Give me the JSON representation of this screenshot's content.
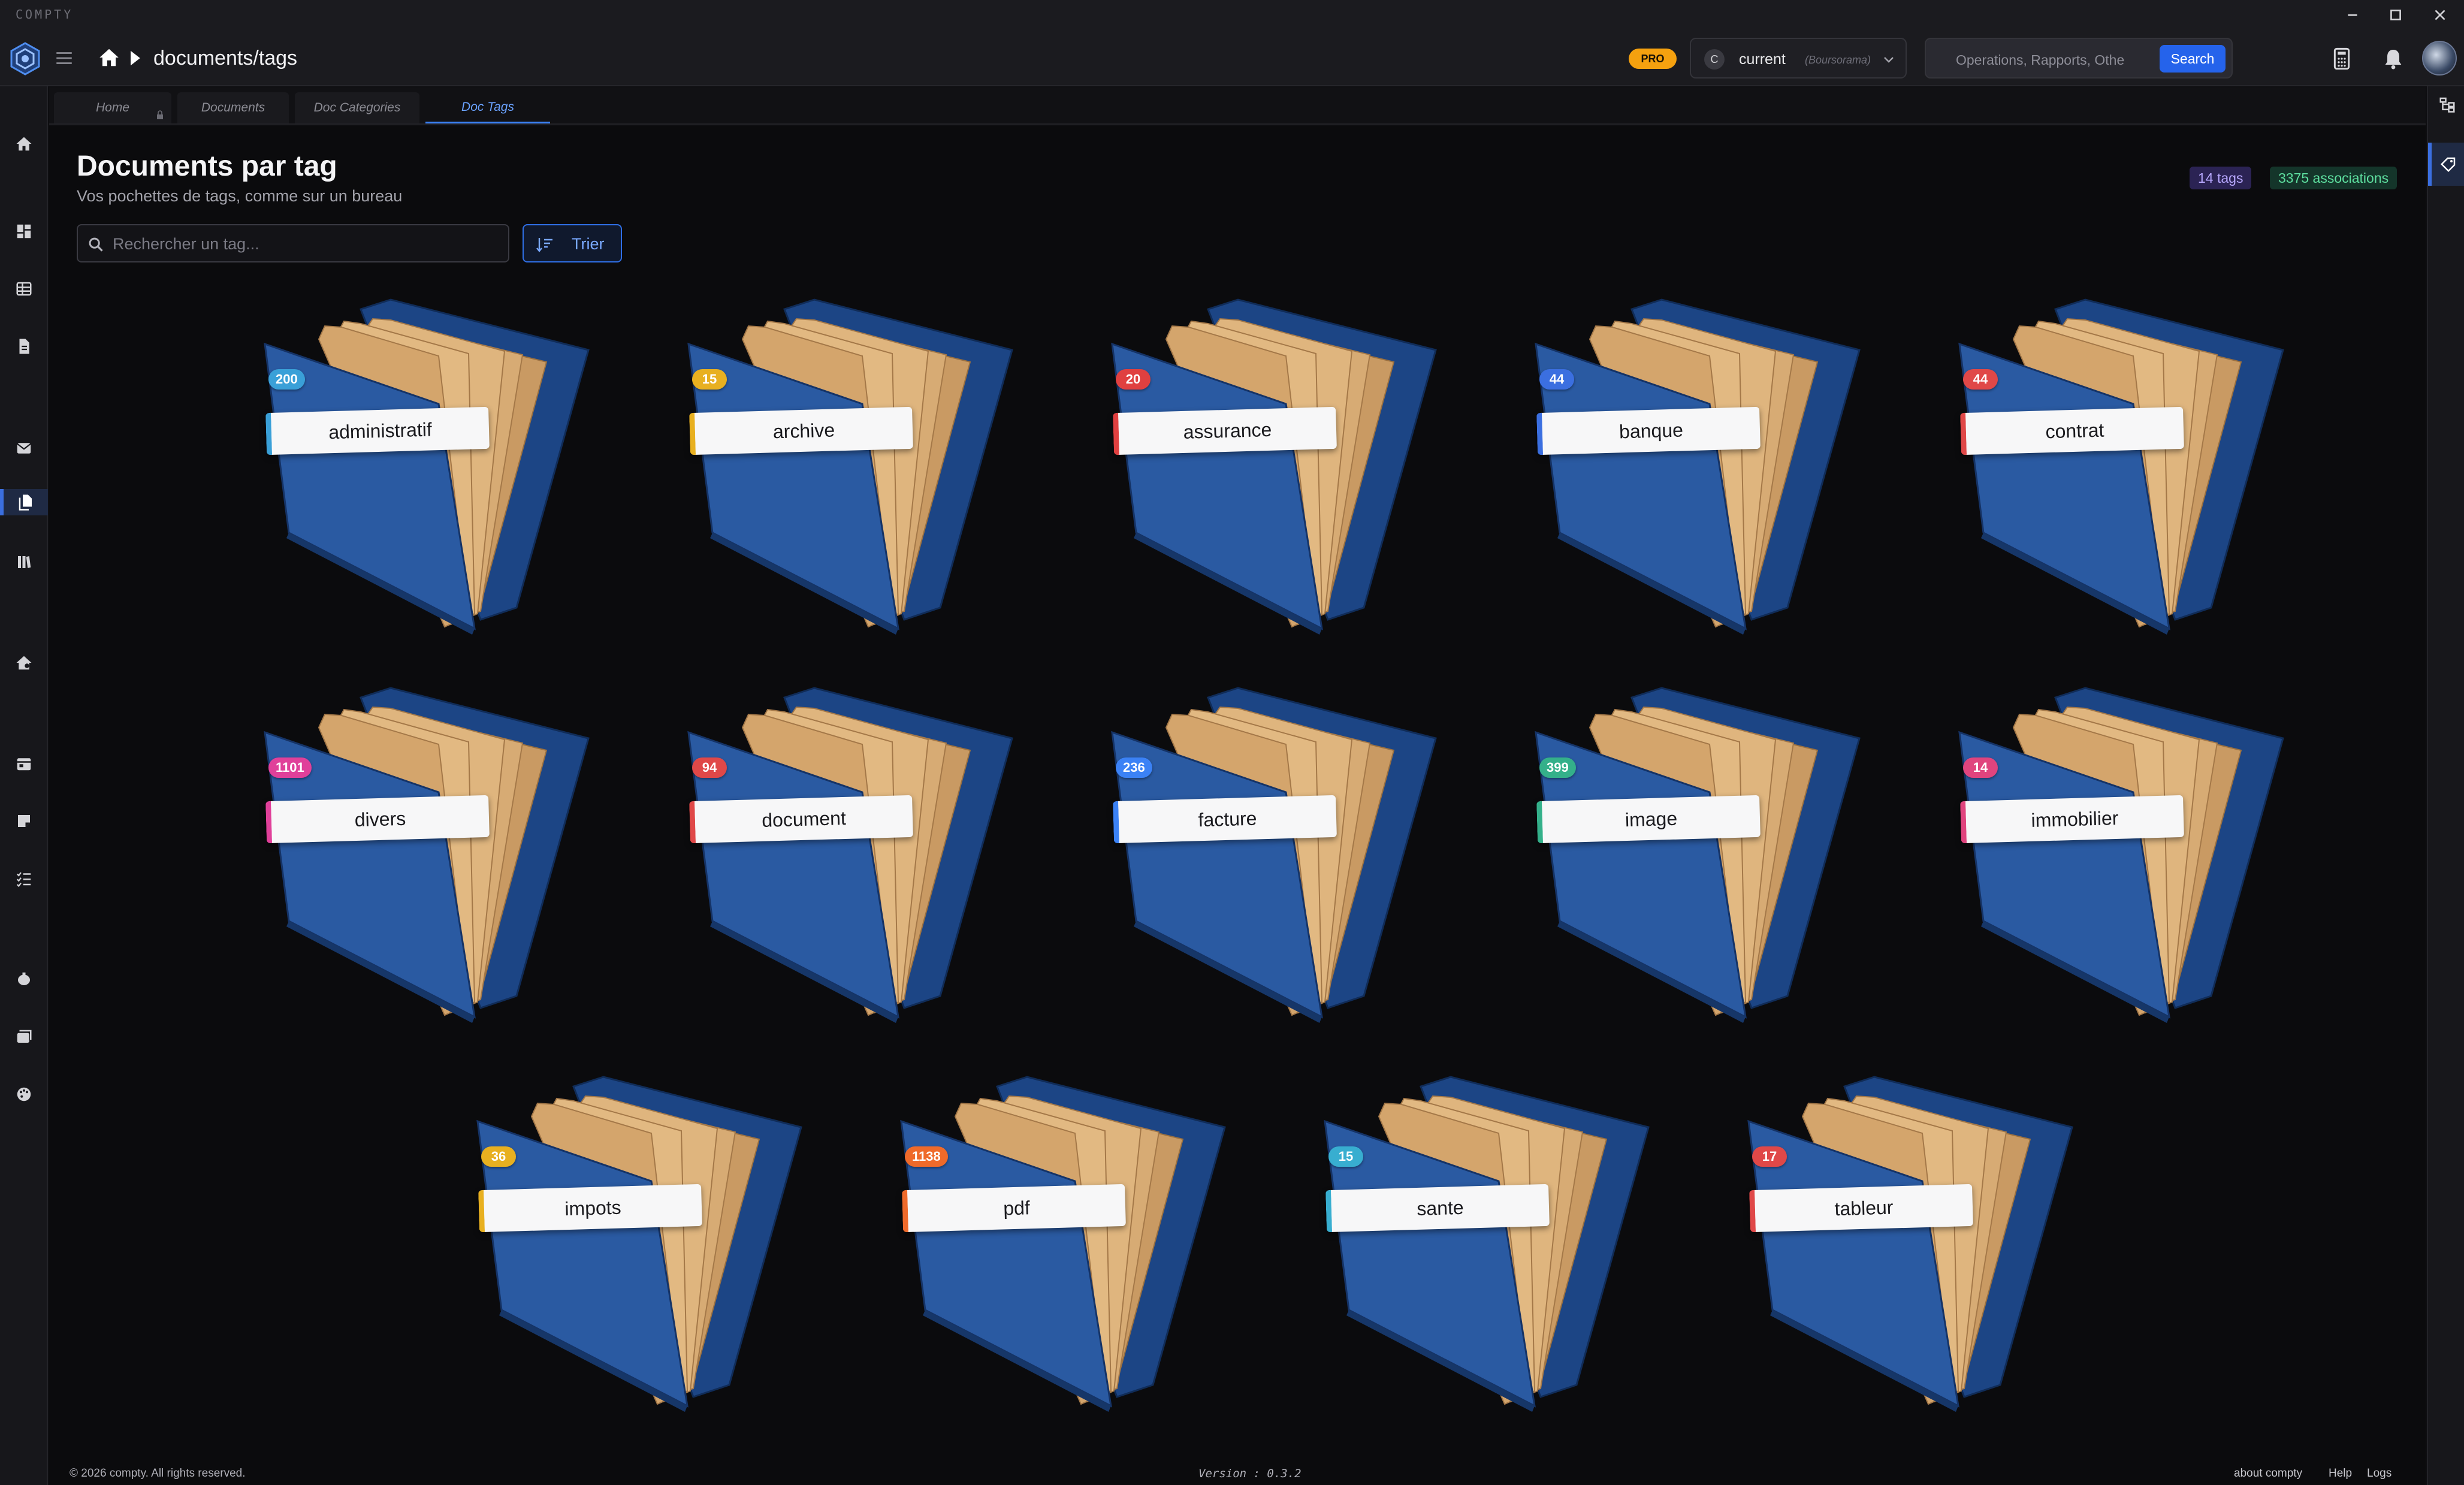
{
  "window": {
    "app_name": "COMPTY"
  },
  "header": {
    "breadcrumb_path": "documents/tags",
    "pro_label": "PRO",
    "org": {
      "avatar_letter": "C",
      "name": "current",
      "sub": "(Boursorama)"
    },
    "search": {
      "placeholder": "Operations, Rapports, Othe",
      "button_label": "Search"
    }
  },
  "tabs": [
    {
      "label": "Home"
    },
    {
      "label": "Documents"
    },
    {
      "label": "Doc Categories"
    },
    {
      "label": "Doc Tags"
    }
  ],
  "page": {
    "title": "Documents par tag",
    "subtitle": "Vos pochettes de tags, comme sur un bureau",
    "tag_count_badge": "14 tags",
    "assoc_badge": "3375 associations",
    "search_placeholder": "Rechercher un tag...",
    "sort_label": "Trier"
  },
  "tags": [
    {
      "name": "administratif",
      "count": "200",
      "color": "#3aa0d8"
    },
    {
      "name": "archive",
      "count": "15",
      "color": "#e8b020"
    },
    {
      "name": "assurance",
      "count": "20",
      "color": "#e04040"
    },
    {
      "name": "banque",
      "count": "44",
      "color": "#3b6fe0"
    },
    {
      "name": "contrat",
      "count": "44",
      "color": "#e04848"
    },
    {
      "name": "divers",
      "count": "1101",
      "color": "#e0409a"
    },
    {
      "name": "document",
      "count": "94",
      "color": "#e04848"
    },
    {
      "name": "facture",
      "count": "236",
      "color": "#3b82f6"
    },
    {
      "name": "image",
      "count": "399",
      "color": "#34b08a"
    },
    {
      "name": "immobilier",
      "count": "14",
      "color": "#e0447e"
    },
    {
      "name": "impots",
      "count": "36",
      "color": "#e8b020"
    },
    {
      "name": "pdf",
      "count": "1138",
      "color": "#ef6a2a"
    },
    {
      "name": "sante",
      "count": "15",
      "color": "#38aed0"
    },
    {
      "name": "tableur",
      "count": "17",
      "color": "#e04848"
    }
  ],
  "footer": {
    "copyright": "© 2026 compty. All rights reserved.",
    "version": "Version : 0.3.2",
    "links": [
      "about compty",
      "Help",
      "Logs"
    ]
  }
}
